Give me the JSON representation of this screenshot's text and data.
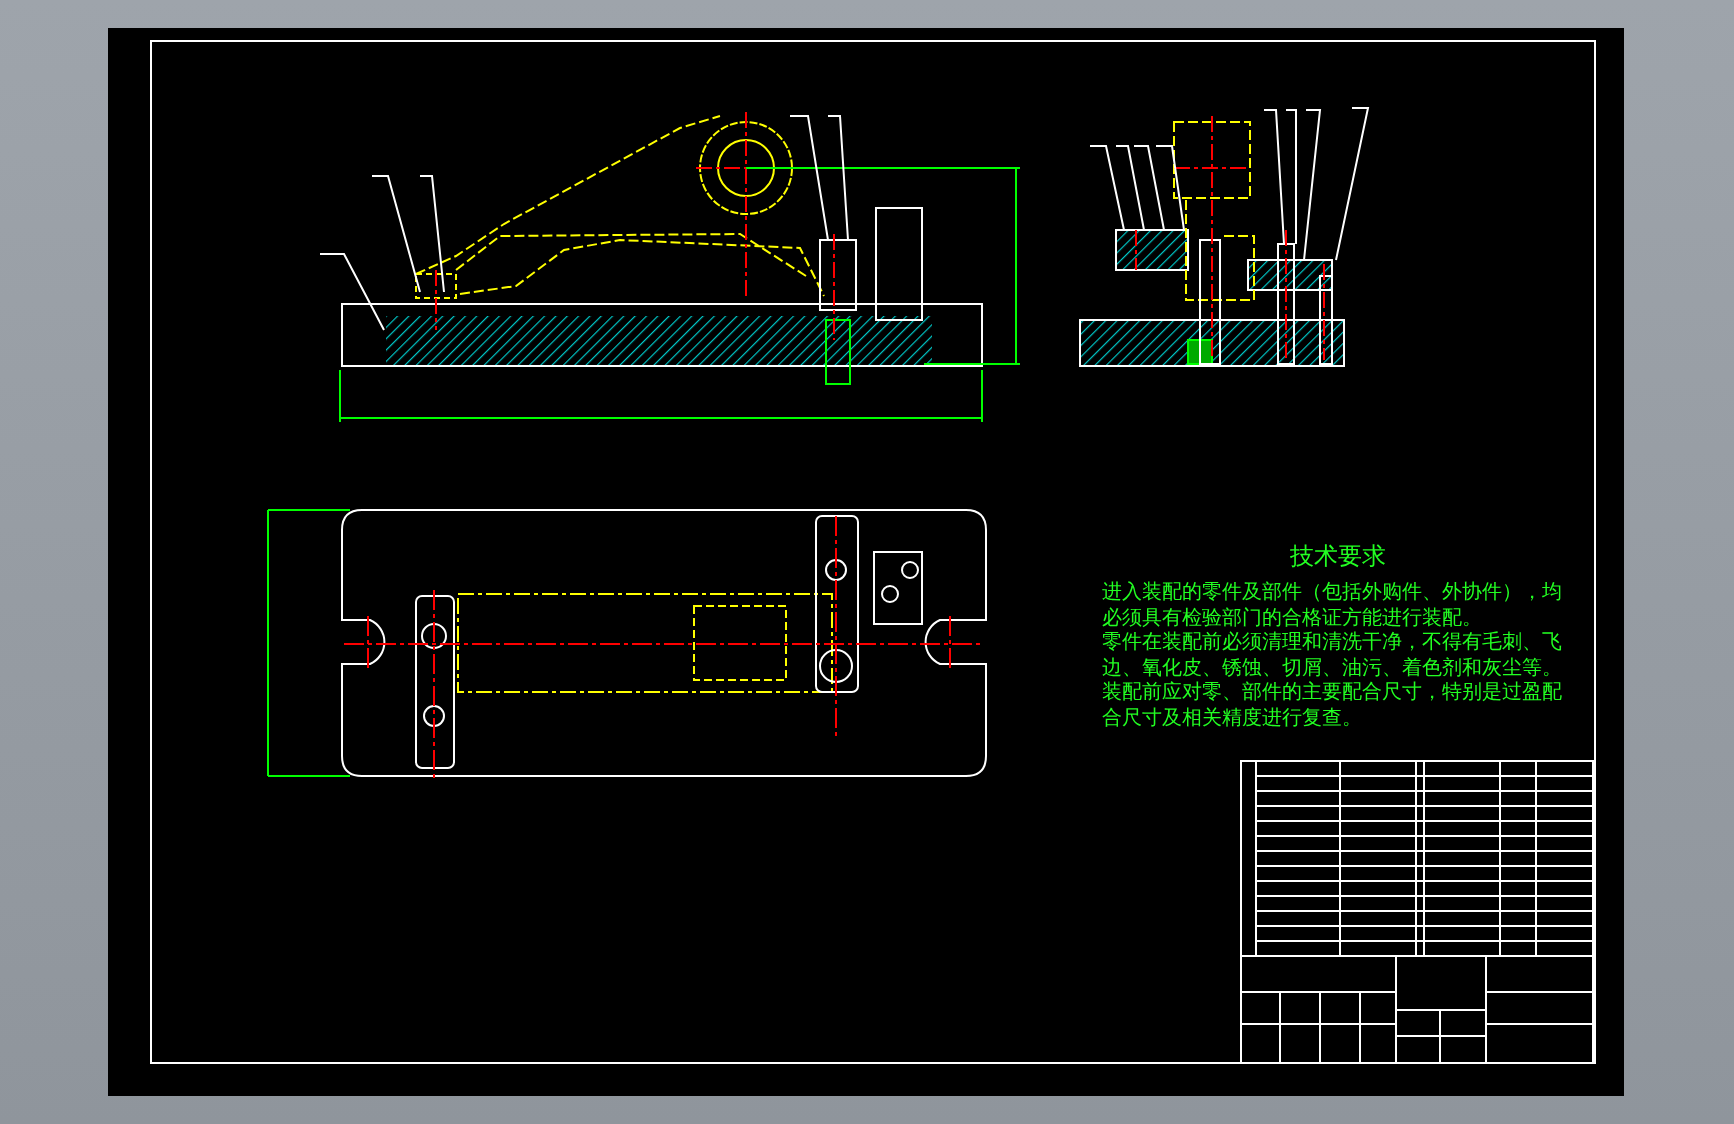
{
  "drawing": {
    "technical_requirements": {
      "title": "技术要求",
      "items": [
        "进入装配的零件及部件（包括外购件、外协件），均必须具有检验部门的合格证方能进行装配。",
        "零件在装配前必须清理和清洗干净，不得有毛刺、飞边、氧化皮、锈蚀、切屑、油污、着色剂和灰尘等。",
        "装配前应对零、部件的主要配合尺寸，特别是过盈配合尺寸及相关精度进行复查。"
      ]
    }
  }
}
